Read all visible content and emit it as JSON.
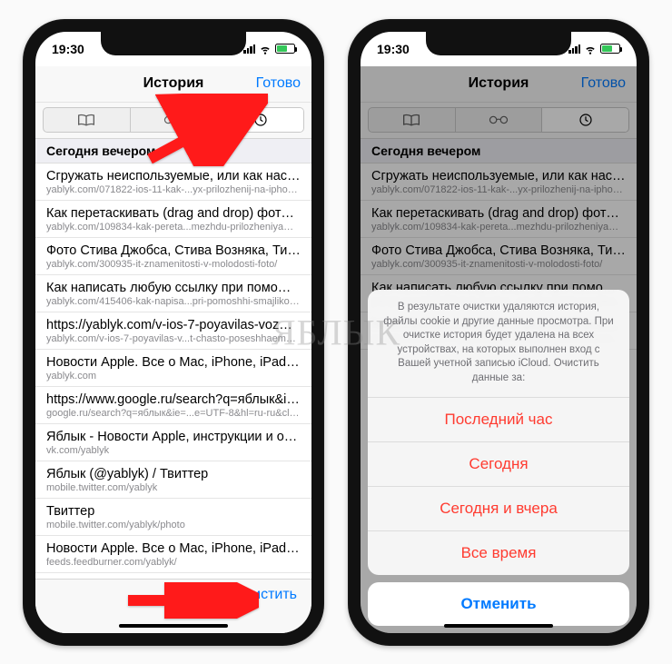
{
  "status": {
    "time": "19:30"
  },
  "nav": {
    "title": "История",
    "done": "Готово"
  },
  "section": "Сегодня вечером",
  "clear": "Очистить",
  "items": [
    {
      "title": "Сгружать неиспользуемые, или как настрои..",
      "url": "yablyk.com/071822-ios-11-kak-...yx-prilozhenij-na-iphone-i-ipad/"
    },
    {
      "title": "Как перетаскивать (drag and drop) фото, тек..",
      "url": "yablyk.com/109834-kak-pereta...mezhdu-prilozheniyami-na-ipad/"
    },
    {
      "title": "Фото Стива Джобса, Стива Возняка, Тима Ку..",
      "url": "yablyk.com/300935-it-znamenitosti-v-molodosti-foto/"
    },
    {
      "title": "Как написать любую ссылку при помощи см..",
      "url": "yablyk.com/415406-kak-napisa...pri-pomoshhi-smajlikov-emodzi/"
    },
    {
      "title": "https://yablyk.com/v-ios-7-poyavilas-vozmozh..",
      "url": "yablyk.com/v-ios-7-poyavilas-v...t-chasto-poseshhaemye-mesta/"
    },
    {
      "title": "Новости Apple. Все о Mac, iPhone, iPad, iOS,..",
      "url": "yablyk.com"
    },
    {
      "title": "https://www.google.ru/search?q=яблык&ie=U..",
      "url": "google.ru/search?q=яблык&ie=...e=UTF-8&hl=ru-ru&client=safari"
    },
    {
      "title": "Яблык - Новости Apple, инструкции и обзор..",
      "url": "vk.com/yablyk"
    },
    {
      "title": "Яблык (@yablyk) / Твиттер",
      "url": "mobile.twitter.com/yablyk"
    },
    {
      "title": "Твиттер",
      "url": "mobile.twitter.com/yablyk/photo"
    },
    {
      "title": "Новости Apple. Все о Mac, iPhone, iPad, iOS,..",
      "url": "feeds.feedburner.com/yablyk/"
    }
  ],
  "items_right_visible": 5,
  "sheet": {
    "message": "В результате очистки удаляются история, файлы cookie и другие данные просмотра. При очистке история будет удалена на всех устройствах, на которых выполнен вход с Вашей учетной записью iCloud. Очистить данные за:",
    "opts": [
      "Последний час",
      "Сегодня",
      "Сегодня и вчера",
      "Все время"
    ],
    "cancel": "Отменить"
  },
  "watermark": "ЯБЛЫК"
}
